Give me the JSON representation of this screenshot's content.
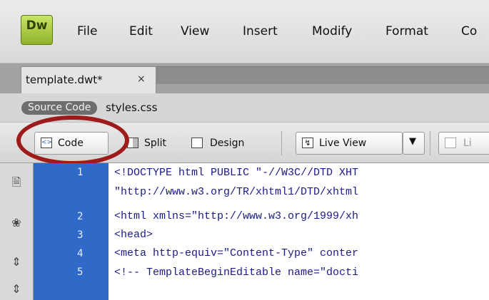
{
  "app": {
    "logo_text": "Dw"
  },
  "menu": {
    "items": [
      "File",
      "Edit",
      "View",
      "Insert",
      "Modify",
      "Format",
      "Co"
    ]
  },
  "tabs": {
    "document": {
      "label": "template.dwt*",
      "close": "×"
    }
  },
  "related_files": {
    "source_code": "Source Code",
    "styles": "styles.css"
  },
  "toolbar": {
    "code": "Code",
    "split": "Split",
    "design": "Design",
    "live_view": "Live View",
    "live_code": "Li"
  },
  "editor": {
    "lines": [
      {
        "num": "1",
        "text": "<!DOCTYPE html PUBLIC \"-//W3C//DTD XHT"
      },
      {
        "num": "",
        "text": "\"http://www.w3.org/TR/xhtml1/DTD/xhtml"
      },
      {
        "num": "2",
        "text": "<html xmlns=\"http://www.w3.org/1999/xh"
      },
      {
        "num": "3",
        "text": "<head>"
      },
      {
        "num": "4",
        "text": "<meta http-equiv=\"Content-Type\" conter"
      },
      {
        "num": "5",
        "text": "<!-- TemplateBeginEditable name=\"docti"
      }
    ]
  },
  "colors": {
    "highlight_circle": "#9e1b1b",
    "line_number_bg": "#2f6ac8",
    "logo_green": "#8fb22b"
  }
}
